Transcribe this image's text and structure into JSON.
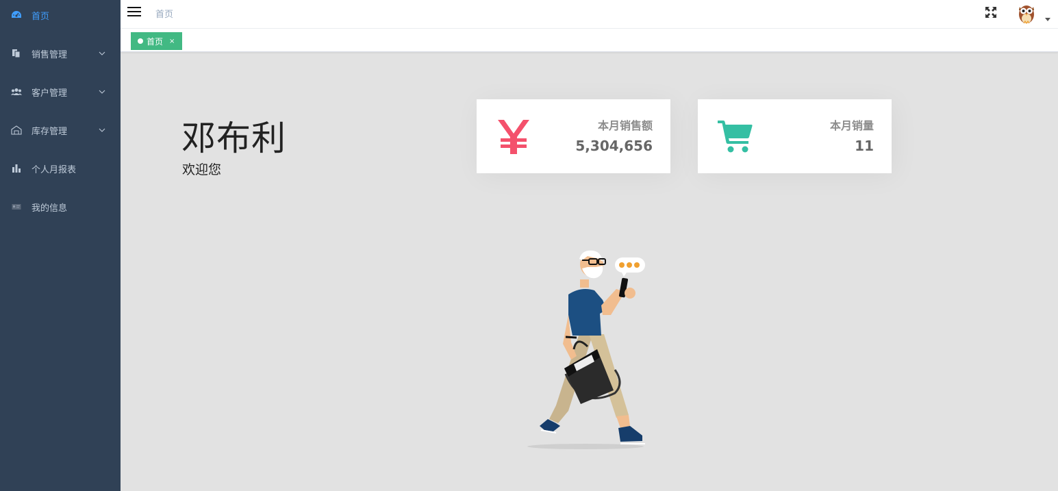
{
  "sidebar": {
    "items": [
      {
        "label": "首页",
        "icon": "dashboard-icon",
        "active": true,
        "has_submenu": false
      },
      {
        "label": "销售管理",
        "icon": "documents-icon",
        "active": false,
        "has_submenu": true
      },
      {
        "label": "客户管理",
        "icon": "people-icon",
        "active": false,
        "has_submenu": true
      },
      {
        "label": "库存管理",
        "icon": "warehouse-icon",
        "active": false,
        "has_submenu": true
      },
      {
        "label": "个人月报表",
        "icon": "bar-chart-icon",
        "active": false,
        "has_submenu": false
      },
      {
        "label": "我的信息",
        "icon": "id-card-icon",
        "active": false,
        "has_submenu": false
      }
    ]
  },
  "navbar": {
    "breadcrumb": "首页"
  },
  "tags": {
    "active_tag": "首页",
    "close_glyph": "×"
  },
  "main": {
    "user_name": "邓布利",
    "welcome": "欢迎您",
    "cards": [
      {
        "title": "本月销售额",
        "value": "5,304,656",
        "icon": "yen-icon",
        "color": "#f4516c"
      },
      {
        "title": "本月销量",
        "value": "11",
        "icon": "shopping-cart-icon",
        "color": "#34bfa3"
      }
    ]
  },
  "colors": {
    "sidebar_bg": "#304156",
    "sidebar_text": "#bfcbd9",
    "active_menu": "#409eff",
    "tag_active": "#42b983",
    "page_bg": "#e2e2e2"
  }
}
